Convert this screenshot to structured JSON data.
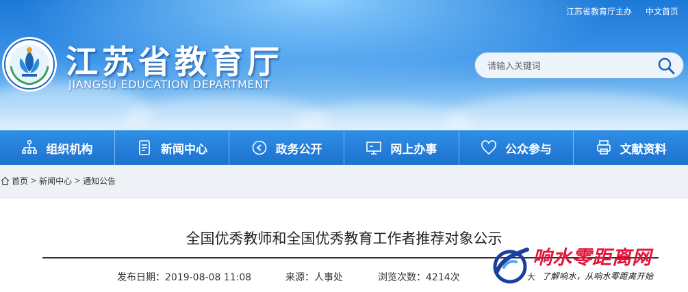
{
  "top_links": {
    "host": "江苏省教育厅主办",
    "lang": "中文首页"
  },
  "site": {
    "title_cn": "江苏省教育厅",
    "title_en": "JIANGSU EDUCATION DEPARTMENT"
  },
  "search": {
    "placeholder": "请输入关键词"
  },
  "nav": {
    "items": [
      {
        "label": "组织机构",
        "icon": "org-chart-icon"
      },
      {
        "label": "新闻中心",
        "icon": "document-icon"
      },
      {
        "label": "政务公开",
        "icon": "play-circle-icon"
      },
      {
        "label": "网上办事",
        "icon": "monitor-icon"
      },
      {
        "label": "公众参与",
        "icon": "heart-icon"
      },
      {
        "label": "文献资料",
        "icon": "printer-icon"
      }
    ]
  },
  "breadcrumb": {
    "items": [
      "首页",
      "新闻中心",
      "通知公告"
    ],
    "separator": ">"
  },
  "article": {
    "title": "全国优秀教师和全国优秀教育工作者推荐对象公示",
    "date": "发布日期：2019-08-08 11:08",
    "source": "来源：人事处",
    "views": "浏览次数：4214次",
    "font_size_label": "大"
  },
  "watermark": {
    "main": "响水零距离网",
    "sub": "了解响水，从响水零距离开始"
  },
  "colors": {
    "nav_blue": "#1c72cf",
    "header_blue": "#1c79d8",
    "watermark_red": "#e3163b"
  }
}
